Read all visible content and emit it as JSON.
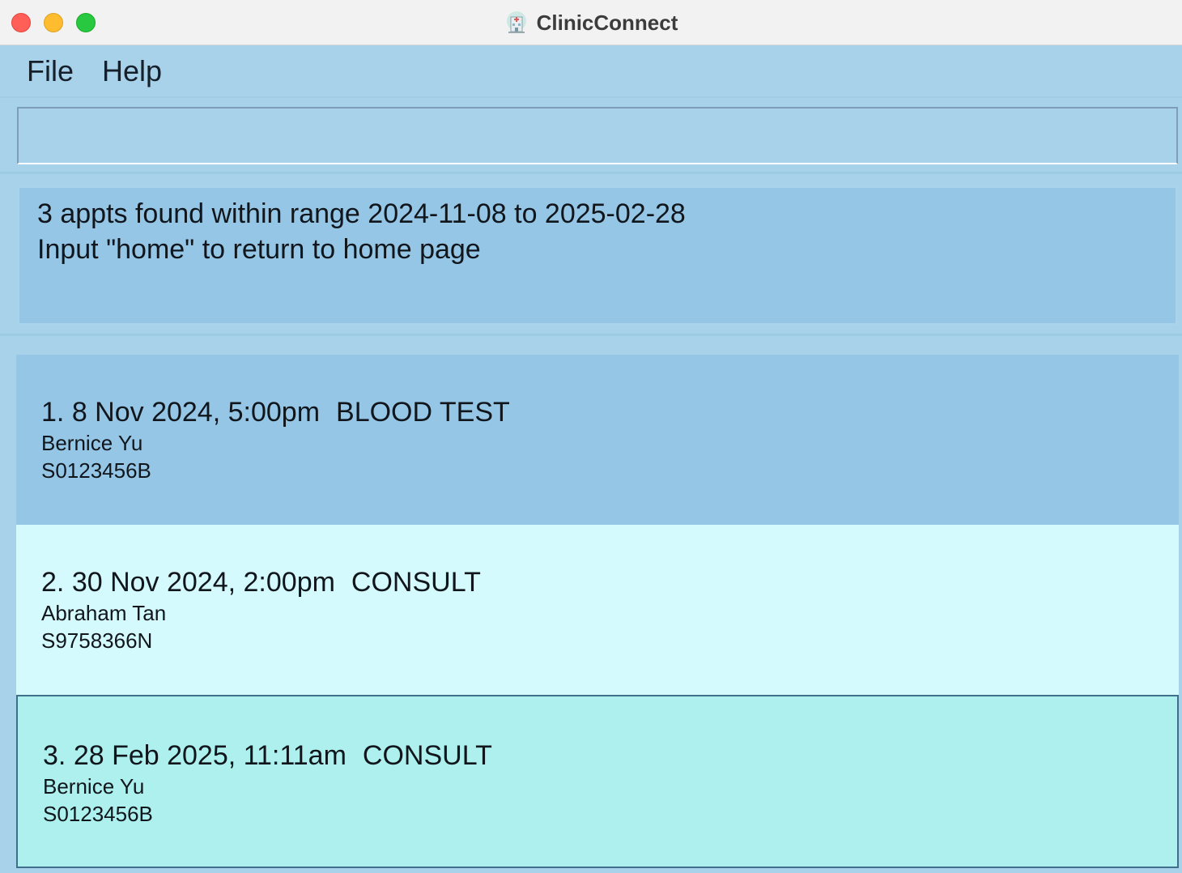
{
  "window": {
    "title": "ClinicConnect"
  },
  "menu": {
    "items": [
      "File",
      "Help"
    ]
  },
  "command": {
    "value": "",
    "placeholder": ""
  },
  "result": {
    "lines": [
      "3 appts found within range 2024-11-08 to 2025-02-28",
      "Input \"home\" to return to home page"
    ]
  },
  "appointments": [
    {
      "index": "1.",
      "datetime": "8 Nov 2024, 5:00pm",
      "type": "BLOOD TEST",
      "name": "Bernice Yu",
      "nric": "S0123456B",
      "background": "#96c6e5"
    },
    {
      "index": "2.",
      "datetime": "30 Nov 2024, 2:00pm",
      "type": "CONSULT",
      "name": "Abraham Tan",
      "nric": "S9758366N",
      "background": "#d5fafd"
    },
    {
      "index": "3.",
      "datetime": "28 Feb 2025, 11:11am",
      "type": "CONSULT",
      "name": "Bernice Yu",
      "nric": "S0123456B",
      "background": "#adf0ed",
      "selected": true
    }
  ],
  "colors": {
    "window_bg": "#a8d2ea",
    "result_bg": "#96c6e5",
    "close": "#ff5f57",
    "minimize": "#febc2e",
    "zoom": "#28c840"
  },
  "icons": {
    "app": "clinic-building-icon"
  }
}
